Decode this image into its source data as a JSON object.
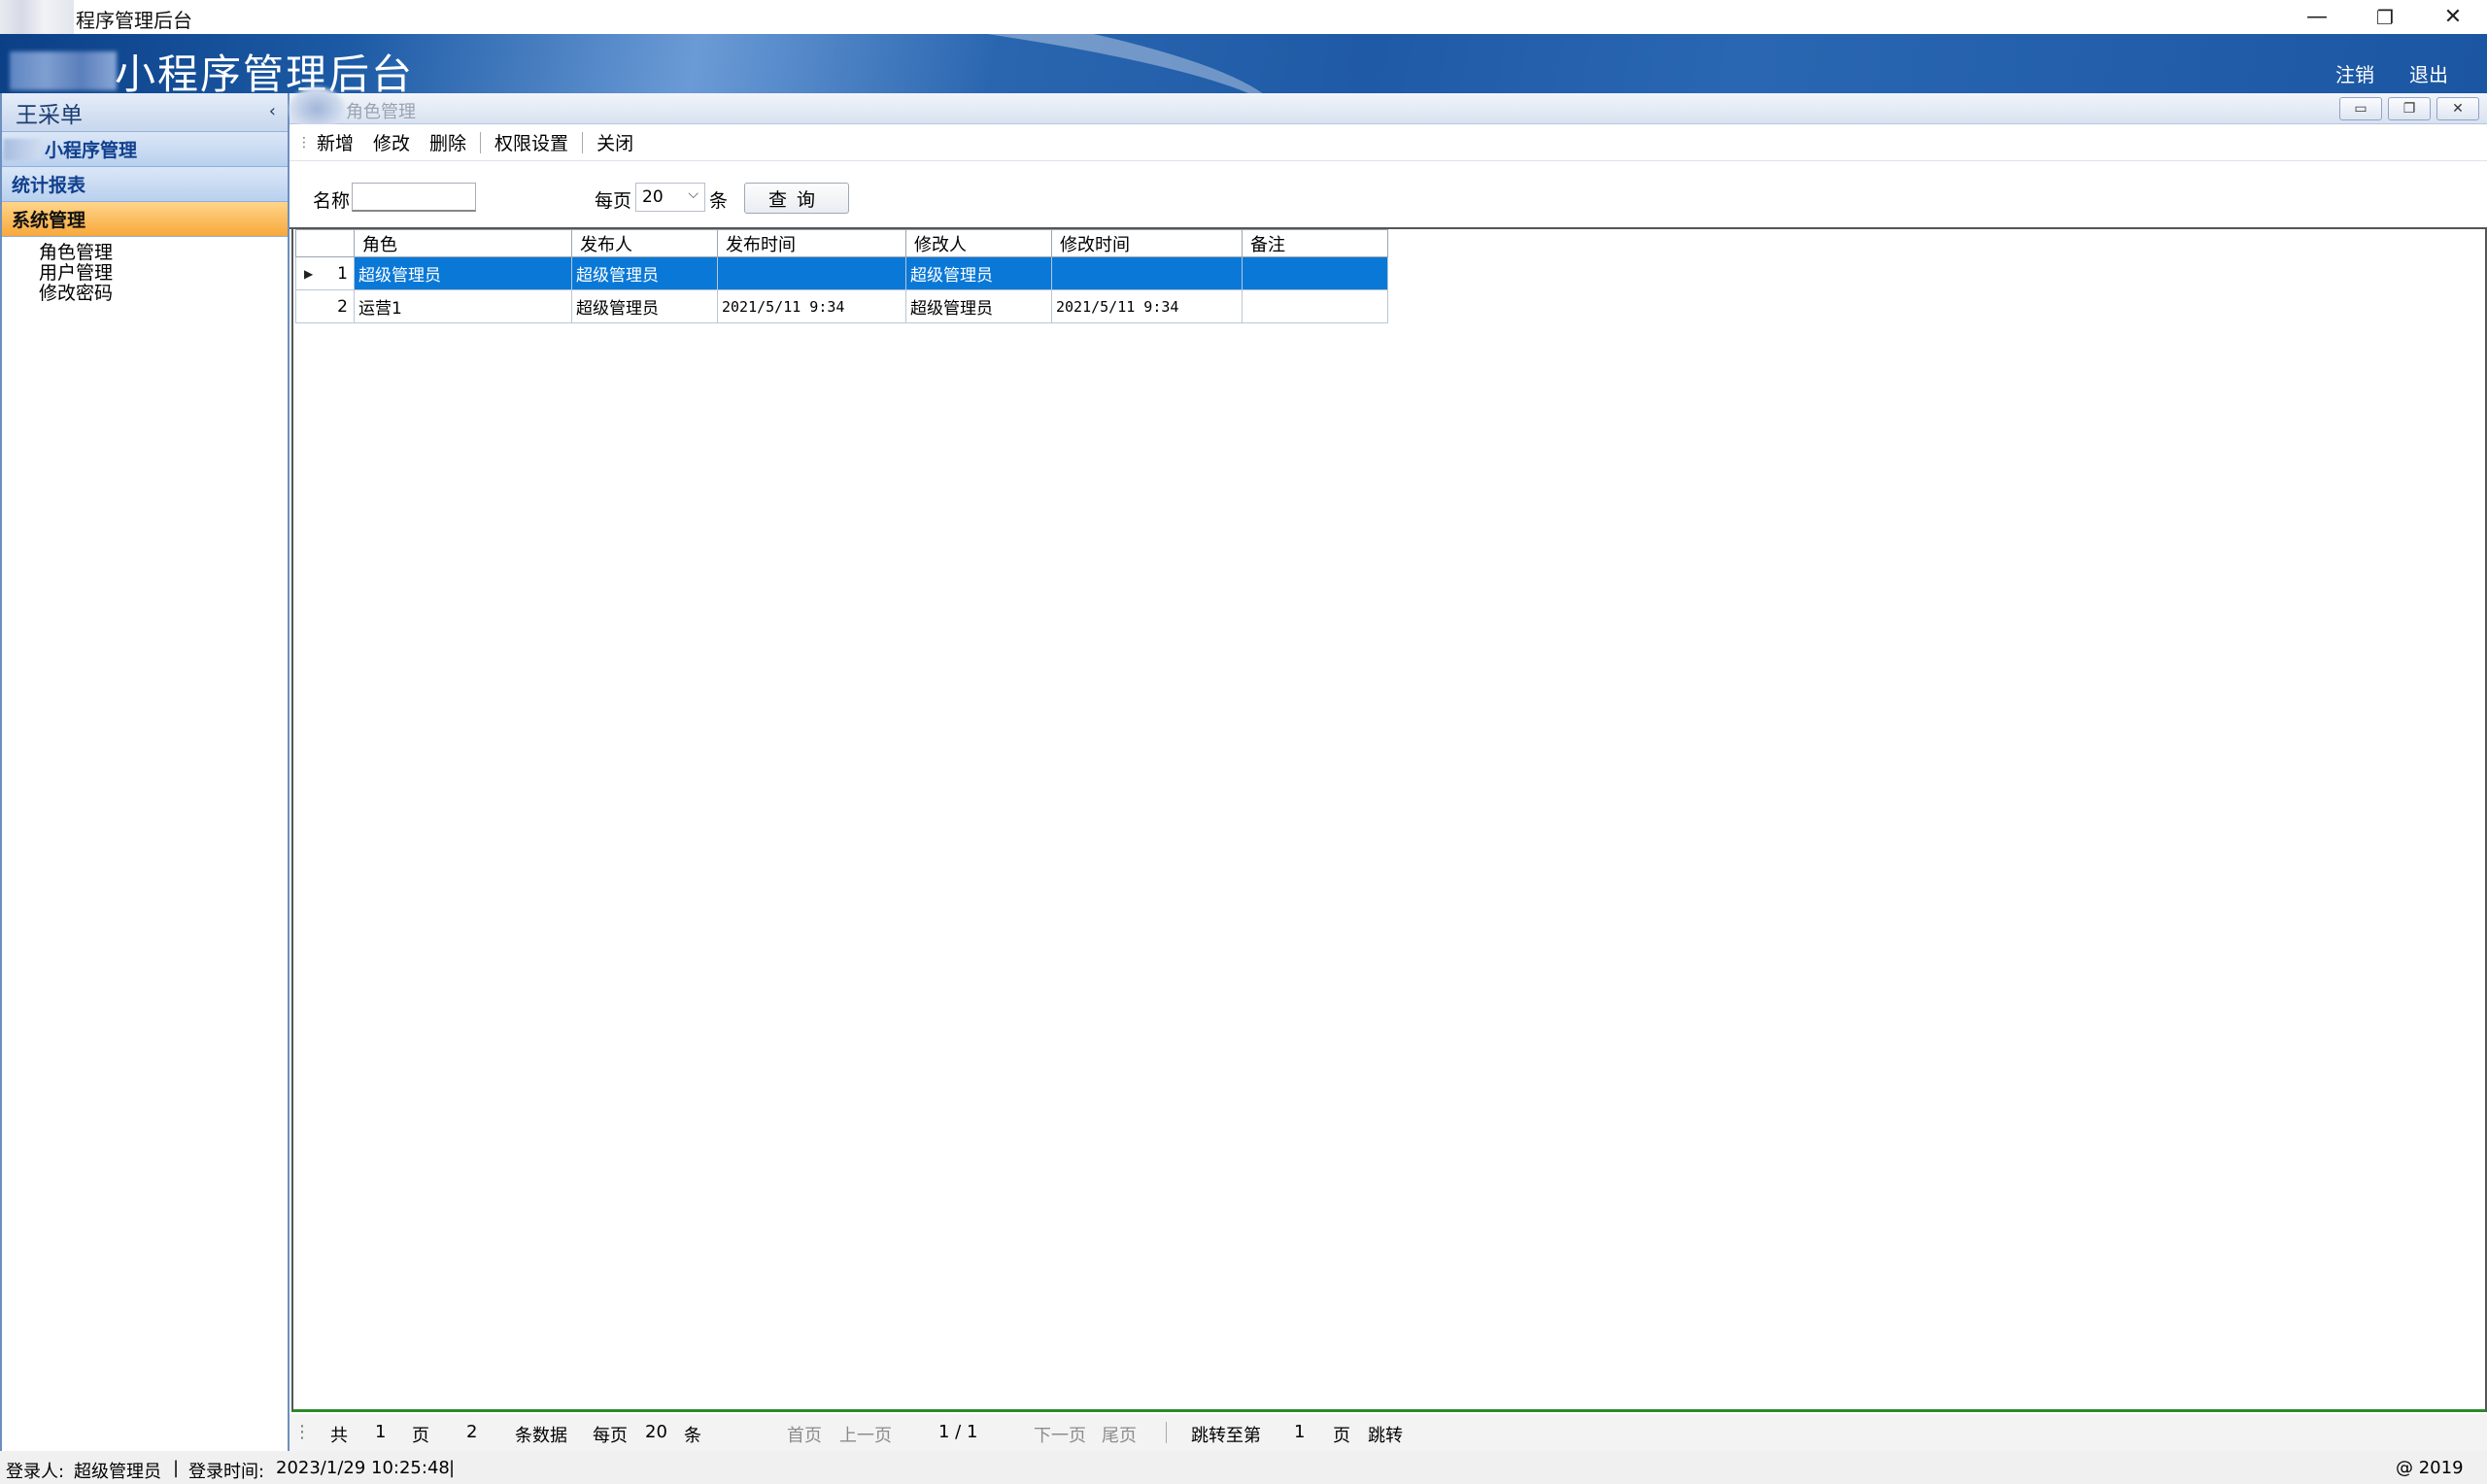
{
  "window": {
    "title": "程序管理后台",
    "controls": {
      "minimize": "—",
      "restore": "❐",
      "close": "✕"
    }
  },
  "banner": {
    "app_title": "小程序管理后台",
    "logout_label": "注销",
    "exit_label": "退出"
  },
  "sidebar": {
    "header": "王采单",
    "collapse_glyph": "‹",
    "groups": [
      {
        "label": "小程序管理"
      },
      {
        "label": "统计报表"
      },
      {
        "label": "系统管理",
        "active": true
      }
    ],
    "sub_items": [
      "角色管理",
      "用户管理",
      "修改密码"
    ]
  },
  "document": {
    "title": "角色管理"
  },
  "toolbar": {
    "add_label": "新增",
    "edit_label": "修改",
    "delete_label": "删除",
    "permission_label": "权限设置",
    "close_label": "关闭"
  },
  "filter": {
    "name_label": "名称",
    "name_value": "",
    "per_page_label": "每页",
    "per_page_value": "20",
    "per_page_unit": "条",
    "query_label": "查询"
  },
  "grid": {
    "columns": [
      "角色",
      "发布人",
      "发布时间",
      "修改人",
      "修改时间",
      "备注"
    ],
    "rows": [
      {
        "index": "1",
        "role": "超级管理员",
        "publisher": "超级管理员",
        "publish_time": "",
        "modifier": "超级管理员",
        "modify_time": "",
        "remark": "",
        "selected": true
      },
      {
        "index": "2",
        "role": "运营1",
        "publisher": "超级管理员",
        "publish_time": "2021/5/11 9:34",
        "modifier": "超级管理员",
        "modify_time": "2021/5/11 9:34",
        "remark": ""
      }
    ]
  },
  "pager": {
    "total_prefix": "共",
    "total_pages": "1",
    "page_unit": "页",
    "total_records": "2",
    "records_unit": "条数据",
    "per_page_label": "每页",
    "per_page_value": "20",
    "per_page_unit": "条",
    "first_label": "首页",
    "prev_label": "上一页",
    "position": "1 / 1",
    "next_label": "下一页",
    "last_label": "尾页",
    "jump_prefix": "跳转至第",
    "jump_value": "1",
    "jump_unit": "页",
    "jump_label": "跳转"
  },
  "status": {
    "user_label": "登录人:",
    "user_value": "超级管理员",
    "time_label": "登录时间:",
    "time_value": "2023/1/29 10:25:48",
    "copyright": "@ 2019"
  }
}
